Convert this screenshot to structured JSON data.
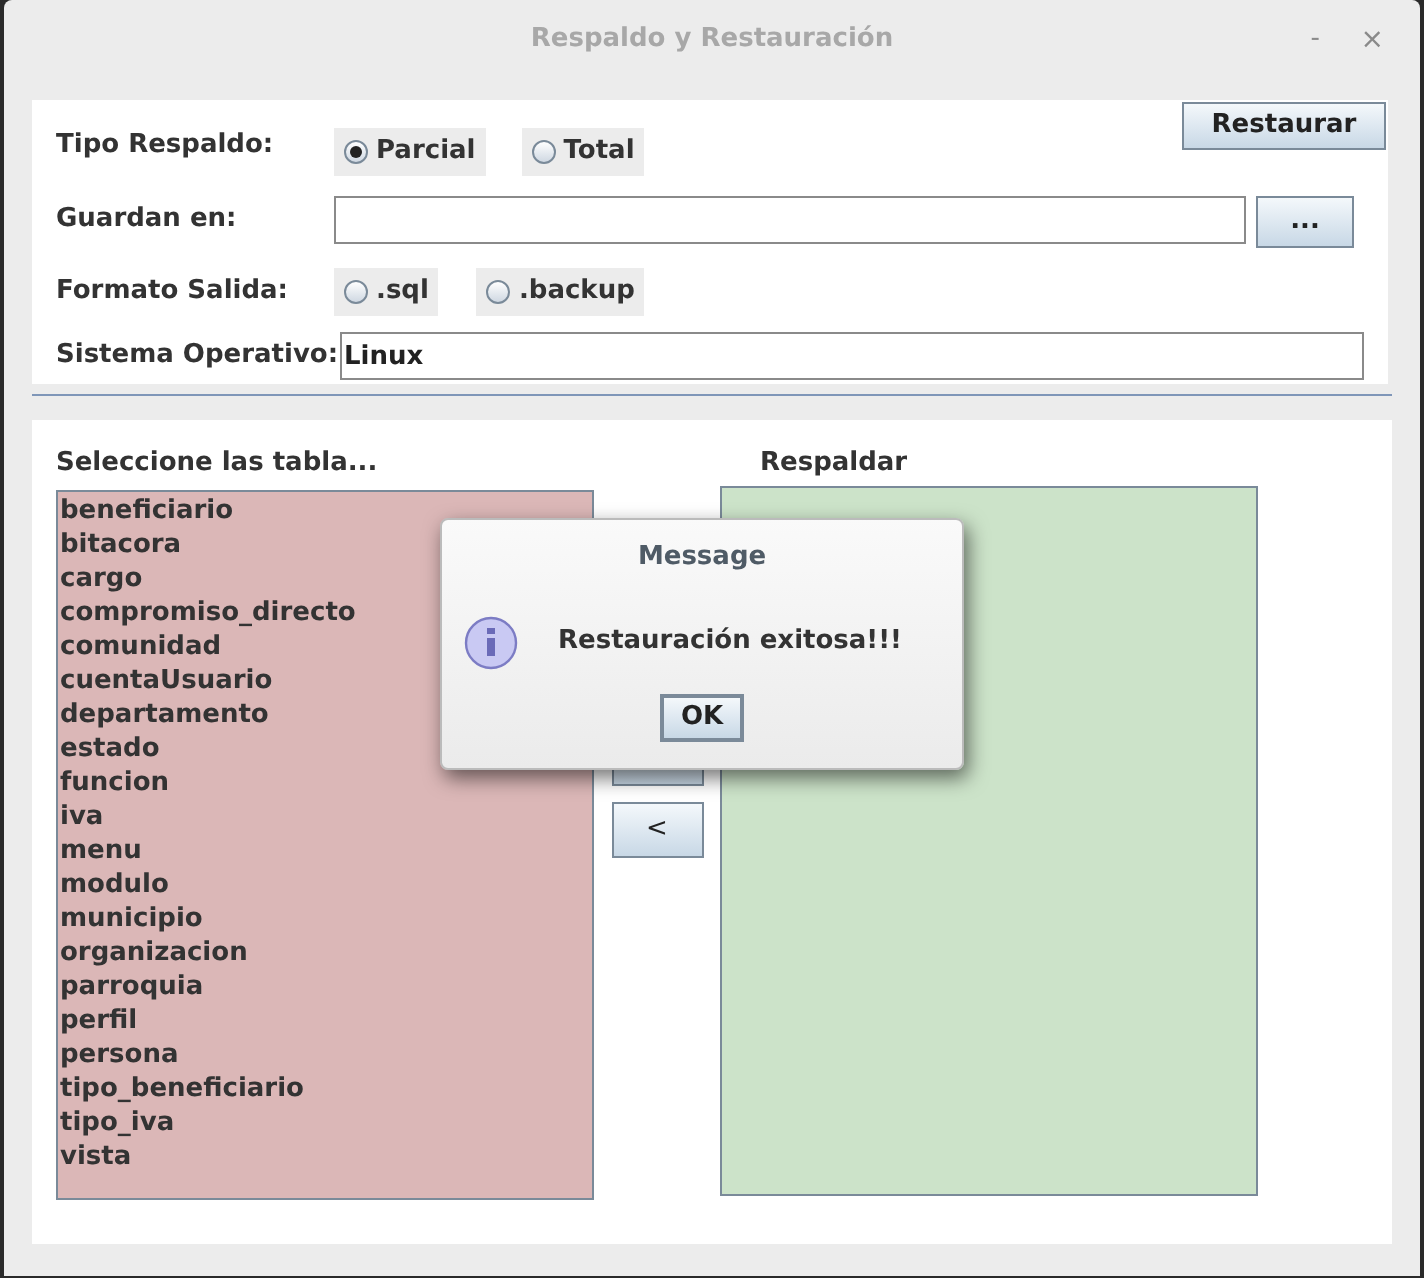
{
  "window": {
    "title": "Respaldo y Restauración",
    "controls": [
      "-",
      "×"
    ]
  },
  "backup_type": {
    "label": "Tipo Respaldo:",
    "options": [
      {
        "label": "Parcial",
        "selected": true
      },
      {
        "label": "Total",
        "selected": false
      }
    ]
  },
  "restore_button": "Restaurar",
  "save_path": {
    "label": "Guardan en:",
    "browse_button": "..."
  },
  "output_format": {
    "label": "Formato Salida:",
    "options": [
      {
        "label": ".sql",
        "selected": false
      },
      {
        "label": ".backup",
        "selected": false
      }
    ]
  },
  "os": {
    "label": "Sistema Operativo:",
    "value": "Linux"
  },
  "tables": {
    "label": "Seleccione las tabla...",
    "items": [
      "beneficiario",
      "bitacora",
      "cargo",
      "compromiso_directo",
      "comunidad",
      "cuentaUsuario",
      "departamento",
      "estado",
      "funcion",
      "iva",
      "menu",
      "modulo",
      "municipio",
      "organizacion",
      "parroquia",
      "perfil",
      "persona",
      "tipo_beneficiario",
      "tipo_iva",
      "vista"
    ]
  },
  "move_buttons": [
    "<"
  ],
  "backup": {
    "label": "Respaldar"
  },
  "dialog": {
    "title": "Message",
    "message": "Restauración exitosa!!!",
    "button": "OK"
  }
}
